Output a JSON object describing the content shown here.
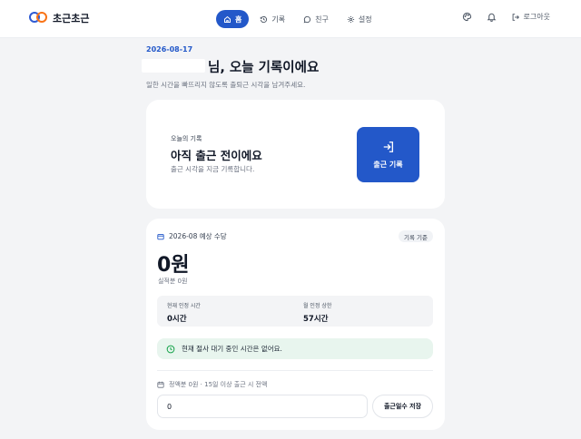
{
  "brand": {
    "name": "초근초근"
  },
  "nav": [
    {
      "label": "홈",
      "icon": "home-icon",
      "active": true
    },
    {
      "label": "기록",
      "icon": "history-icon",
      "active": false
    },
    {
      "label": "친구",
      "icon": "chat-icon",
      "active": false
    },
    {
      "label": "설정",
      "icon": "gear-icon",
      "active": false
    }
  ],
  "header": {
    "logout_label": "로그아웃"
  },
  "page": {
    "date": "2026-08-17",
    "greeting": "님, 오늘 기록이에요",
    "subtitle": "일한 시간을 빠뜨리지 않도록 출퇴근 시각을 남겨주세요."
  },
  "today": {
    "label": "오늘의 기록",
    "status": "아직 출근 전이에요",
    "hint": "출근 시각을 지금 기록합니다.",
    "button_label": "출근 기록"
  },
  "pay": {
    "title": "2026-08 예상 수당",
    "badge": "기록 기준",
    "amount": "0원",
    "actual": "실적분 0원",
    "current_hours_label": "현재 인정 시간",
    "current_hours_value": "0시간",
    "monthly_cap_label": "월 인정 상한",
    "monthly_cap_value": "57시간",
    "notice": "현재 절사 대기 중인 시간은 없어요.",
    "base_label": "정액분 0원 · 15일 이상 출근 시 전액",
    "days_value": "0",
    "save_label": "출근일수 저장"
  },
  "colors": {
    "accent": "#2358c9",
    "notice_bg": "#e8f5ee",
    "notice_icon": "#16a34a"
  }
}
